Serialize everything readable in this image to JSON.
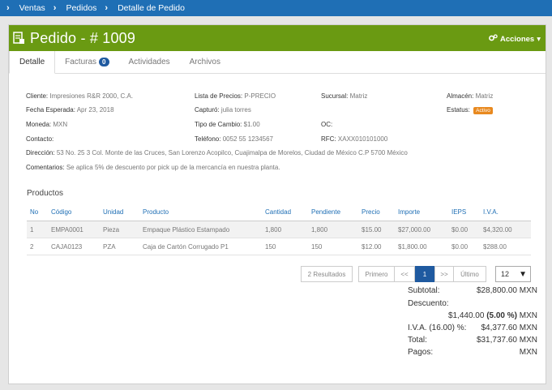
{
  "breadcrumb": {
    "items": [
      "Ventas",
      "Pedidos",
      "Detalle de Pedido"
    ]
  },
  "header": {
    "title": "Pedido - # 1009",
    "actions_label": "Acciones"
  },
  "tabs": [
    {
      "label": "Detalle",
      "active": true
    },
    {
      "label": "Facturas",
      "badge": "0"
    },
    {
      "label": "Actividades"
    },
    {
      "label": "Archivos"
    }
  ],
  "info": {
    "cliente_label": "Cliente:",
    "cliente": "Impresiones R&R 2000, C.A.",
    "lista_label": "Lista de Precios:",
    "lista": "P-PRECIO",
    "sucursal_label": "Sucursal:",
    "sucursal": "Matriz",
    "almacen_label": "Almacén:",
    "almacen": "Matriz",
    "fecha_label": "Fecha Esperada:",
    "fecha": "Apr 23, 2018",
    "capturo_label": "Capturó:",
    "capturo": "julia torres",
    "estatus_label": "Estatus:",
    "estatus": "Activo",
    "moneda_label": "Moneda:",
    "moneda": "MXN",
    "tipo_label": "Tipo de Cambio:",
    "tipo": "$1.00",
    "oc_label": "OC:",
    "oc": "",
    "contacto_label": "Contacto:",
    "contacto": "",
    "telefono_label": "Teléfono:",
    "telefono": "0052 55 1234567",
    "rfc_label": "RFC:",
    "rfc": "XAXX010101000",
    "direccion_label": "Dirección:",
    "direccion": "53 No. 25 3 Col. Monte de las Cruces, San Lorenzo Acopilco, Cuajimalpa de Morelos, Ciudad de México C.P 5700 México",
    "comentarios_label": "Comentarios:",
    "comentarios": "Se aplica 5% de descuento por pick up de la mercancía en nuestra planta."
  },
  "products": {
    "title": "Productos",
    "columns": [
      "No",
      "Código",
      "Unidad",
      "Producto",
      "Cantidad",
      "Pendiente",
      "Precio",
      "Importe",
      "IEPS",
      "I.V.A."
    ],
    "rows": [
      [
        "1",
        "EMPA0001",
        "Pieza",
        "Empaque Plástico Estampado",
        "1,800",
        "1,800",
        "$15.00",
        "$27,000.00",
        "$0.00",
        "$4,320.00"
      ],
      [
        "2",
        "CAJA0123",
        "PZA",
        "Caja de Cartón Corrugado P1",
        "150",
        "150",
        "$12.00",
        "$1,800.00",
        "$0.00",
        "$288.00"
      ]
    ]
  },
  "pagination": {
    "results": "2 Resultados",
    "first": "Primero",
    "prev": "<<",
    "page": "1",
    "next": ">>",
    "last": "Último",
    "page_size": "12"
  },
  "totals": {
    "subtotal_label": "Subtotal:",
    "subtotal": "$28,800.00 MXN",
    "descuento_label": "Descuento:",
    "descuento_amount": "$1,440.00 ",
    "descuento_pct": "(5.00 %)",
    "descuento_cur": " MXN",
    "iva_label": "I.V.A. (16.00) %:",
    "iva": "$4,377.60 MXN",
    "total_label": "Total:",
    "total": "$31,737.60 MXN",
    "pagos_label": "Pagos:",
    "pagos": "MXN"
  },
  "colors": {
    "accent": "#1f6fb5",
    "header_green": "#6a9a12",
    "status_orange": "#e8891f"
  }
}
